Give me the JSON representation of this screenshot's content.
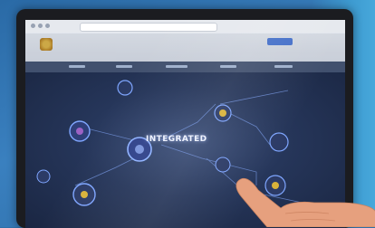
{
  "browser": {
    "address_text": ""
  },
  "site": {
    "title": "",
    "subtitle": ""
  },
  "hero": {
    "title": "INTEGRATED"
  },
  "colors": {
    "screen_bg": "#1c2a47",
    "node_outline": "#7fa6ff",
    "accent_gold": "#d8b23a",
    "hand_skin": "#e6a07e"
  }
}
